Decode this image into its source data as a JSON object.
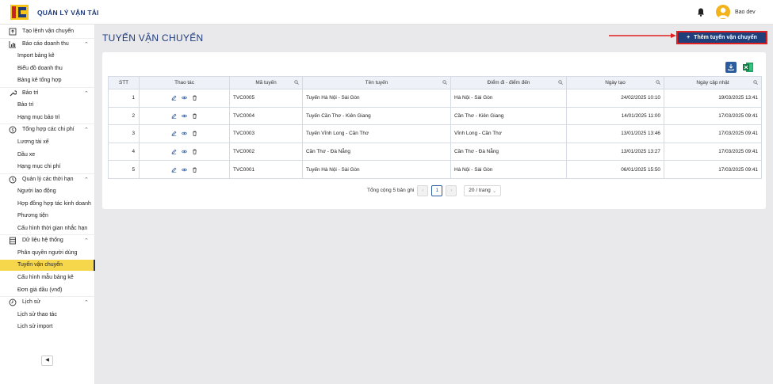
{
  "app": {
    "title": "QUẢN LÝ VẬN TẢI",
    "user_name": "Bao dev"
  },
  "sidebar": {
    "items": [
      {
        "type": "group",
        "label": "Tạo lệnh vận chuyển",
        "icon": "upload-icon"
      },
      {
        "type": "group",
        "label": "Báo cáo doanh thu",
        "icon": "chart-icon",
        "expanded": true
      },
      {
        "type": "sub",
        "label": "Import bảng kê"
      },
      {
        "type": "sub",
        "label": "Biểu đồ doanh thu"
      },
      {
        "type": "sub",
        "label": "Bảng kê tổng hợp"
      },
      {
        "type": "group",
        "label": "Bảo trì",
        "icon": "wrench-icon",
        "expanded": true
      },
      {
        "type": "sub",
        "label": "Bảo trì"
      },
      {
        "type": "sub",
        "label": "Hạng mục bảo trì"
      },
      {
        "type": "group",
        "label": "Tổng hợp các chi phí",
        "icon": "dollar-icon",
        "expanded": true
      },
      {
        "type": "sub",
        "label": "Lương tài xế"
      },
      {
        "type": "sub",
        "label": "Dầu xe"
      },
      {
        "type": "sub",
        "label": "Hạng mục chi phí"
      },
      {
        "type": "group",
        "label": "Quản lý các thời hạn",
        "icon": "clock-icon",
        "expanded": true
      },
      {
        "type": "sub",
        "label": "Người lao động"
      },
      {
        "type": "sub",
        "label": "Hợp đồng hợp tác kinh doanh"
      },
      {
        "type": "sub",
        "label": "Phương tiện"
      },
      {
        "type": "sub",
        "label": "Cấu hình thời gian nhắc hạn"
      },
      {
        "type": "group",
        "label": "Dữ liệu hệ thống",
        "icon": "database-icon",
        "expanded": true
      },
      {
        "type": "sub",
        "label": "Phân quyền người dùng"
      },
      {
        "type": "sub",
        "label": "Tuyến vận chuyển",
        "active": true
      },
      {
        "type": "sub",
        "label": "Cấu hình mẫu bảng kê"
      },
      {
        "type": "sub",
        "label": "Đơn giá dầu (vnđ)"
      },
      {
        "type": "group",
        "label": "Lịch sử",
        "icon": "history-icon",
        "expanded": true
      },
      {
        "type": "sub",
        "label": "Lịch sử thao tác"
      },
      {
        "type": "sub",
        "label": "Lịch sử import"
      }
    ]
  },
  "page": {
    "title": "TUYẾN VẬN CHUYỂN",
    "add_button": "Thêm tuyến vận chuyển"
  },
  "table": {
    "headers": {
      "stt": "STT",
      "actions": "Thao tác",
      "code": "Mã tuyến",
      "name": "Tên tuyến",
      "endpoints": "Điểm đi - điểm đến",
      "created": "Ngày tạo",
      "updated": "Ngày cập nhật"
    },
    "rows": [
      {
        "stt": "1",
        "code": "TVC0005",
        "name": "Tuyến Hà Nội - Sài Gòn",
        "endpoints": "Hà Nội - Sài Gòn",
        "created": "24/02/2025 10:10",
        "updated": "19/03/2025 13:41"
      },
      {
        "stt": "2",
        "code": "TVC0004",
        "name": "Tuyến Cần Thơ - Kiên Giang",
        "endpoints": "Cần Thơ - Kiên Giang",
        "created": "14/01/2025 11:00",
        "updated": "17/03/2025 09:41"
      },
      {
        "stt": "3",
        "code": "TVC0003",
        "name": "Tuyến Vĩnh Long - Cần Thơ",
        "endpoints": "Vĩnh Long - Cần Thơ",
        "created": "13/01/2025 13:46",
        "updated": "17/03/2025 09:41"
      },
      {
        "stt": "4",
        "code": "TVC0002",
        "name": "Cần Thơ - Đà Nẵng",
        "endpoints": "Cần Thơ - Đà Nẵng",
        "created": "13/01/2025 13:27",
        "updated": "17/03/2025 09:41"
      },
      {
        "stt": "5",
        "code": "TVC0001",
        "name": "Tuyến Hà Nội - Sài Gòn",
        "endpoints": "Hà Nội - Sài Gòn",
        "created": "06/01/2025 15:50",
        "updated": "17/03/2025 09:41"
      }
    ]
  },
  "pagination": {
    "total_text": "Tổng cộng 5 bản ghi",
    "current_page": "1",
    "page_size": "20 / trang"
  },
  "colors": {
    "primary": "#1f3f7a",
    "active_menu": "#f6d64a",
    "highlight": "#e02020"
  }
}
